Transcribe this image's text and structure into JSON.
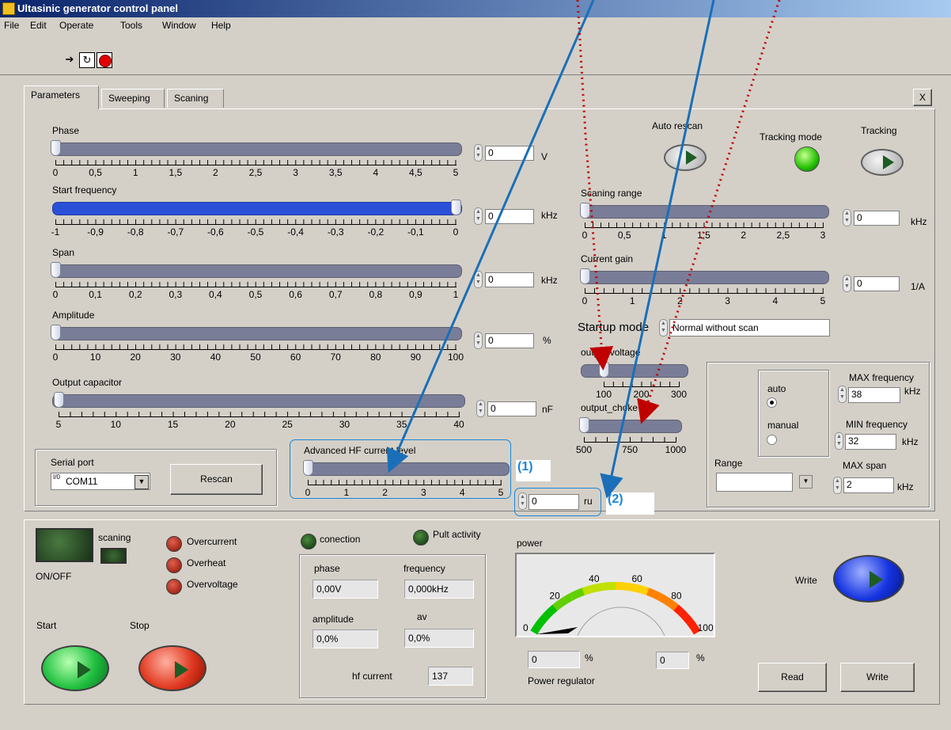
{
  "window": {
    "title": "Ultasinic generator control panel"
  },
  "menu": [
    "File",
    "Edit",
    "Operate",
    "Tools",
    "Window",
    "Help"
  ],
  "toolbar": {
    "run_icon": "run-arrow-icon",
    "continuous_icon": "run-continuous-icon",
    "abort_icon": "abort-icon"
  },
  "tabs": [
    "Parameters",
    "Sweeping",
    "Scaning"
  ],
  "close_label": "X",
  "sliders": {
    "phase": {
      "label": "Phase",
      "ticks": [
        "0",
        "0,5",
        "1",
        "1,5",
        "2",
        "2,5",
        "3",
        "3,5",
        "4",
        "4,5",
        "5"
      ],
      "value": "0",
      "unit": "V",
      "level": 0
    },
    "start_frequency": {
      "label": "Start frequency",
      "ticks": [
        "-1",
        "-0,9",
        "-0,8",
        "-0,7",
        "-0,6",
        "-0,5",
        "-0,4",
        "-0,3",
        "-0,2",
        "-0,1",
        "0"
      ],
      "value": "0",
      "unit": "kHz",
      "level": 1
    },
    "span": {
      "label": "Span",
      "ticks": [
        "0",
        "0,1",
        "0,2",
        "0,3",
        "0,4",
        "0,5",
        "0,6",
        "0,7",
        "0,8",
        "0,9",
        "1"
      ],
      "value": "0",
      "unit": "kHz",
      "level": 0
    },
    "amplitude": {
      "label": "Amplitude",
      "ticks": [
        "0",
        "10",
        "20",
        "30",
        "40",
        "50",
        "60",
        "70",
        "80",
        "90",
        "100"
      ],
      "value": "0",
      "unit": "%",
      "level": 0
    },
    "output_capacitor": {
      "label": "Output capacitor",
      "ticks": [
        "5",
        "10",
        "15",
        "20",
        "25",
        "30",
        "35",
        "40"
      ],
      "value": "0",
      "unit": "nF",
      "level": 0
    },
    "advanced_hf": {
      "label": "Advanced HF current level",
      "ticks": [
        "0",
        "1",
        "2",
        "3",
        "4",
        "5"
      ],
      "value": "0",
      "unit": "ru",
      "level": 0
    },
    "scaning_range": {
      "label": "Scaning range",
      "ticks": [
        "0",
        "0,5",
        "1",
        "1,5",
        "2",
        "2,5",
        "3"
      ],
      "value": "0",
      "unit": "kHz",
      "level": 0
    },
    "current_gain": {
      "label": "Current gain",
      "ticks": [
        "0",
        "1",
        "2",
        "3",
        "4",
        "5"
      ],
      "value": "0",
      "unit": "1/A",
      "level": 0
    },
    "output_voltage": {
      "label": "output voltage",
      "ticks": [
        "100",
        "200",
        "300"
      ],
      "level": 0
    },
    "output_choke": {
      "label": "output_choke",
      "ticks": [
        "500",
        "750",
        "1000"
      ],
      "level": 0
    }
  },
  "auto_rescan": {
    "label": "Auto rescan"
  },
  "tracking_mode": {
    "label": "Tracking mode"
  },
  "tracking": {
    "label": "Tracking"
  },
  "startup_mode": {
    "label": "Startup mode",
    "value": "Normal without scan"
  },
  "range_group": {
    "auto_label": "auto",
    "manual_label": "manual",
    "range_label": "Range",
    "max_freq_label": "MAX frequency",
    "max_freq_value": "38",
    "max_freq_unit": "kHz",
    "min_freq_label": "MIN frequency",
    "min_freq_value": "32",
    "min_freq_unit": "kHz",
    "max_span_label": "MAX span",
    "max_span_value": "2",
    "max_span_unit": "kHz"
  },
  "serial_port": {
    "label": "Serial port",
    "value": "COM11",
    "prefix": "I/0",
    "rescan_label": "Rescan"
  },
  "annotations": {
    "one": "(1)",
    "two": "(2)"
  },
  "status": {
    "on_off": "ON/OFF",
    "scaning": "scaning",
    "overcurrent": "Overcurrent",
    "overheat": "Overheat",
    "overvoltage": "Overvoltage",
    "connection": "conection",
    "pult": "Pult activity",
    "start": "Start",
    "stop": "Stop"
  },
  "readout": {
    "phase_label": "phase",
    "phase_value": "0,00V",
    "frequency_label": "frequency",
    "frequency_value": "0,000kHz",
    "amplitude_label": "amplitude",
    "amplitude_value": "0,0%",
    "av_label": "av",
    "av_value": "0,0%",
    "hf_label": "hf current",
    "hf_value": "137"
  },
  "power": {
    "label": "power",
    "gauge_ticks": [
      "0",
      "20",
      "40",
      "60",
      "80",
      "100"
    ],
    "level": 0,
    "reg_value1": "0",
    "reg_unit1": "%",
    "reg_value2": "0",
    "reg_unit2": "%",
    "regulator_label": "Power regulator"
  },
  "write_label": "Write",
  "read_button": "Read",
  "write_button": "Write",
  "colors": {
    "accent_blue": "#1b86d6",
    "annotation_red": "#c00000",
    "track_blue": "#2b50d8"
  }
}
